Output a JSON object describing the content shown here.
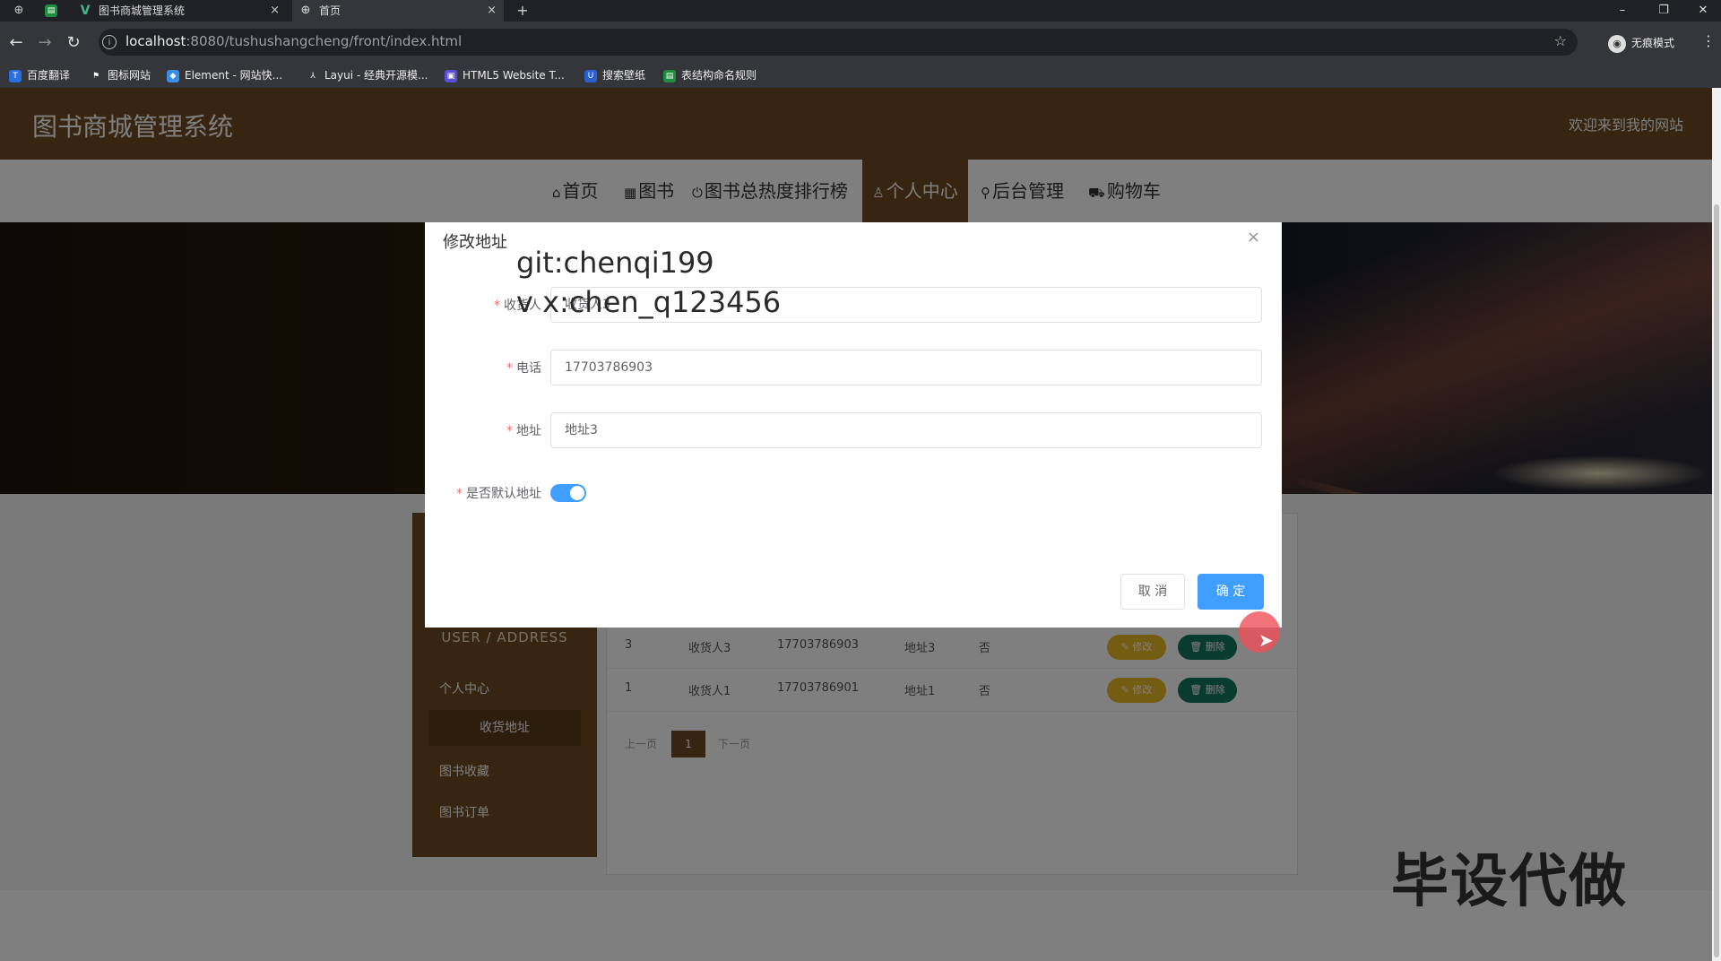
{
  "browser": {
    "tabs": [
      {
        "title": "图书商城管理系统",
        "close": "×"
      },
      {
        "title": "首页",
        "close": "×"
      }
    ],
    "new_tab": "+",
    "window_controls": {
      "minimize": "–",
      "restore": "❐",
      "close": "✕"
    },
    "url_host": "localhost",
    "url_rest": ":8080/tushushangcheng/front/index.html",
    "incognito_label": "无痕模式",
    "bookmarks": [
      "百度翻译",
      "图标网站",
      "Element - 网站快...",
      "Layui - 经典开源模...",
      "HTML5 Website T...",
      "搜索壁纸",
      "表结构命名规则"
    ]
  },
  "site": {
    "title": "图书商城管理系统",
    "welcome": "欢迎来到我的网站",
    "nav": [
      "首页",
      "图书",
      "图书总热度排行榜",
      "个人中心",
      "后台管理",
      "购物车"
    ],
    "nav_active": "个人中心"
  },
  "sidebar": {
    "heading": "USER / ADDRESS",
    "items": [
      "个人中心",
      "收货地址",
      "图书收藏",
      "图书订单"
    ],
    "active": "收货地址"
  },
  "address_table": {
    "rows": [
      {
        "id": "3",
        "name": "收货人3",
        "phone": "17703786903",
        "address": "地址3",
        "default": "否"
      },
      {
        "id": "1",
        "name": "收货人1",
        "phone": "17703786901",
        "address": "地址1",
        "default": "否"
      }
    ],
    "edit_label": "修改",
    "delete_label": "删除",
    "prev": "上一页",
    "current_page": "1",
    "next": "下一页"
  },
  "dialog": {
    "title": "修改地址",
    "close": "×",
    "fields": [
      {
        "label": "收货人",
        "value": "收货人3"
      },
      {
        "label": "电话",
        "value": "17703786903"
      },
      {
        "label": "地址",
        "value": "地址3"
      }
    ],
    "default_label": "是否默认地址",
    "default_on": true,
    "cancel": "取 消",
    "confirm": "确 定"
  },
  "watermarks": {
    "line1": "git:chenqi199",
    "line2": "v x:chen_q123456",
    "corner": "毕设代做"
  },
  "colors": {
    "brand_brown": "#6e4a22",
    "primary": "#409eff",
    "edit": "#e9b825",
    "delete": "#13785e"
  }
}
